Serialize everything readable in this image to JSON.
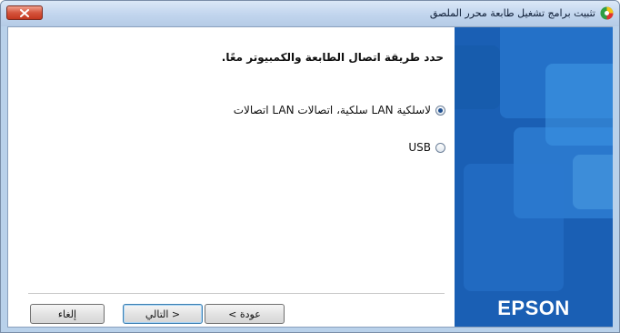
{
  "window": {
    "title": "تثبيت برامج تشغيل طابعة محرر الملصق"
  },
  "main": {
    "heading": "حدد طريقة اتصال الطابعة والكمبيوتر معًا.",
    "options": [
      {
        "label": "اتصالات LAN سلكية، اتصالات LAN لاسلكية",
        "selected": true
      },
      {
        "label": "USB",
        "selected": false
      }
    ]
  },
  "buttons": {
    "cancel": "إلغاء",
    "next": "التالي >",
    "back": "< عودة"
  },
  "brand": {
    "logo_text": "EPSON",
    "panel_color": "#1a5fb4"
  }
}
